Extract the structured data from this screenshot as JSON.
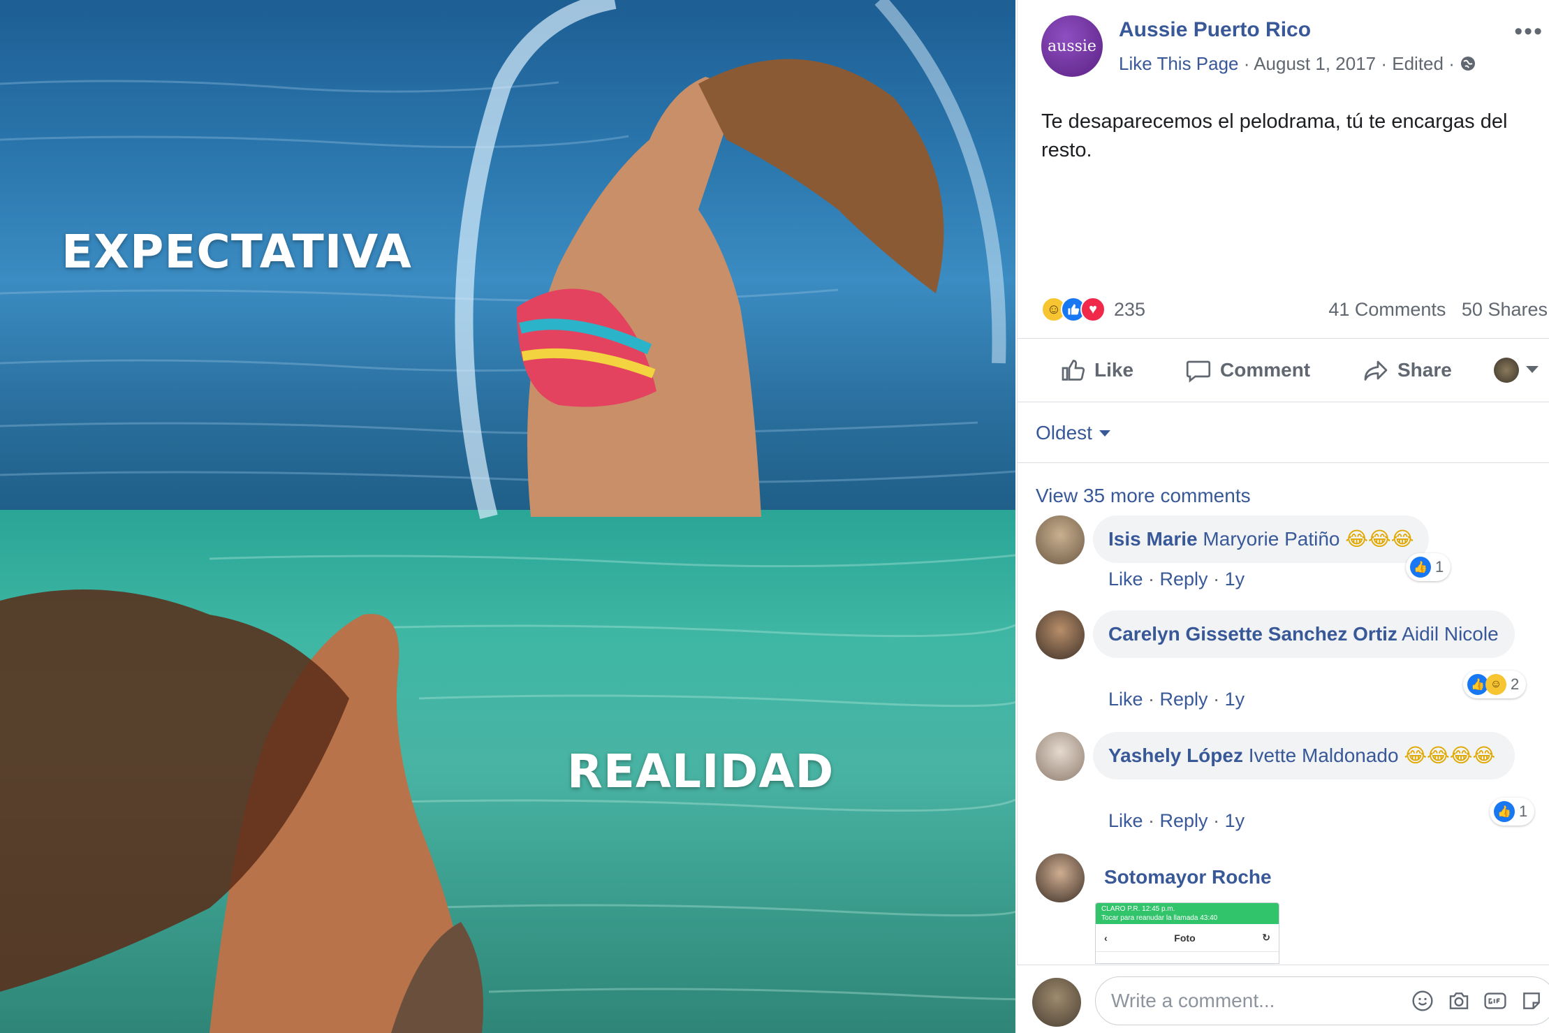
{
  "photo": {
    "text_top": "EXPECTATIVA",
    "text_bottom": "REALIDAD"
  },
  "post": {
    "page_name": "Aussie Puerto Rico",
    "avatar_text": "aussie",
    "like_page": "Like This Page",
    "date": "August 1, 2017",
    "edited": "Edited",
    "text": "Te desaparecemos el pelodrama, tú te encargas del resto.",
    "reaction_count": "235",
    "comments_count": "41 Comments",
    "shares_count": "50 Shares",
    "actions": {
      "like": "Like",
      "comment": "Comment",
      "share": "Share"
    },
    "sort_label": "Oldest",
    "view_more": "View 35 more comments"
  },
  "comments": [
    {
      "name": "Isis Marie",
      "tag": "Maryorie Patiño",
      "emoji": "😂😂😂",
      "reactions": "1",
      "like": "Like",
      "reply": "Reply",
      "time": "1y"
    },
    {
      "name": "Carelyn Gissette Sanchez Ortiz",
      "tag": "Aidil Nicole",
      "emoji": "",
      "reactions": "2",
      "like": "Like",
      "reply": "Reply",
      "time": "1y"
    },
    {
      "name": "Yashely López",
      "tag": "Ivette Maldonado",
      "emoji": "😂😂😂😂",
      "reactions": "1",
      "like": "Like",
      "reply": "Reply",
      "time": "1y"
    },
    {
      "name": "Sotomayor Roche"
    }
  ],
  "screenshot_attachment": {
    "status_line": "CLARO P.R.  12:45 p.m.",
    "status_line2": "Tocar para reanudar la llamada 43:40",
    "title": "Foto"
  },
  "composer": {
    "placeholder": "Write a comment..."
  },
  "colors": {
    "link_blue": "#385898",
    "meta_gray": "#606770",
    "brand_purple": "#6a2a95"
  }
}
